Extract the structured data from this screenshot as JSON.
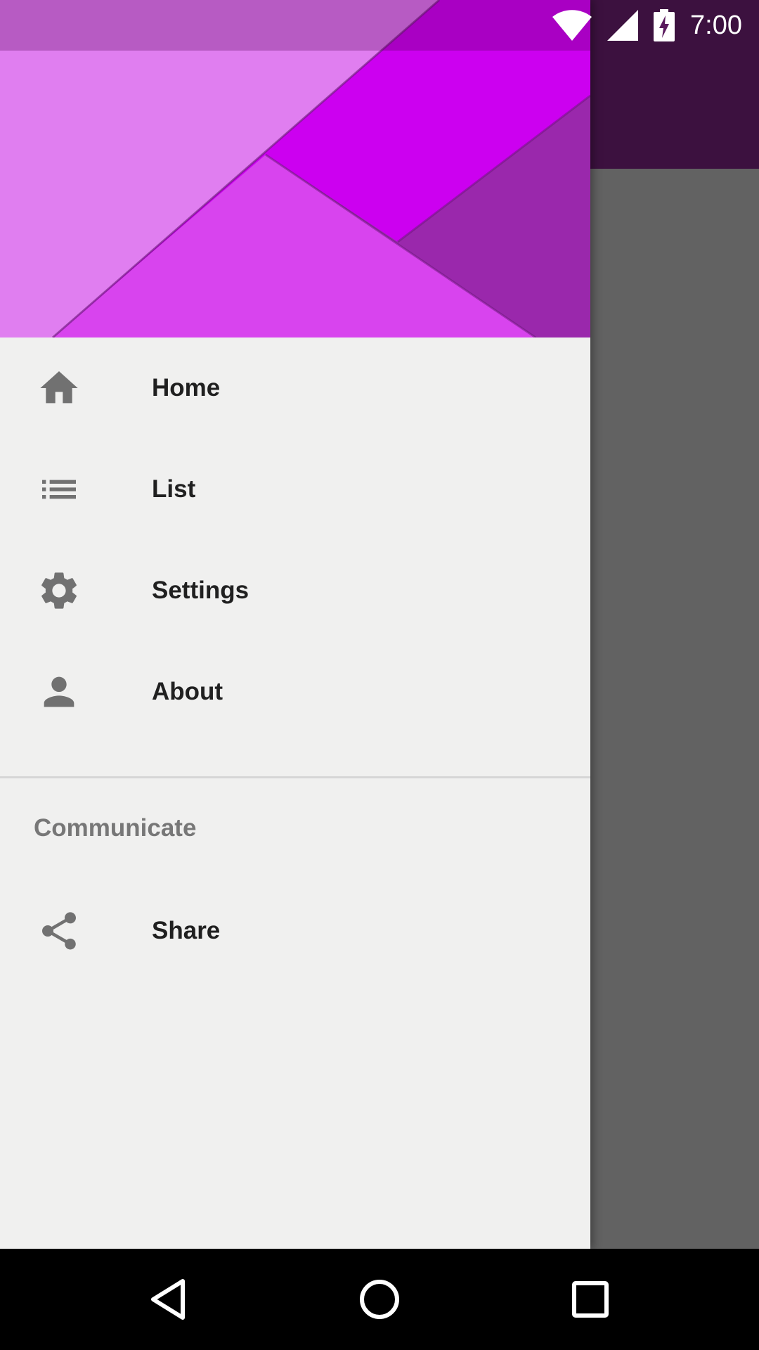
{
  "status_bar": {
    "time": "7:00",
    "icons": [
      "wifi-icon",
      "cell-signal-icon",
      "battery-charging-icon"
    ]
  },
  "drawer": {
    "menu_items": [
      {
        "label": "Home",
        "icon": "home-icon"
      },
      {
        "label": "List",
        "icon": "list-icon"
      },
      {
        "label": "Settings",
        "icon": "settings-gear-icon"
      },
      {
        "label": "About",
        "icon": "person-icon"
      }
    ],
    "section_title": "Communicate",
    "section_items": [
      {
        "label": "Share",
        "icon": "share-icon"
      }
    ]
  },
  "nav_bar": {
    "buttons": [
      "back-icon",
      "home-circle-icon",
      "recents-square-icon"
    ]
  },
  "colors": {
    "header_light": "#e07ef0",
    "header_magenta": "#cc00f0",
    "header_mid": "#d844ee",
    "header_dark": "#9a28ac",
    "toolbar_scrim": "#3c113f",
    "content_scrim": "#626262",
    "drawer_bg": "#f0f0ef",
    "icon_gray": "#717171"
  }
}
